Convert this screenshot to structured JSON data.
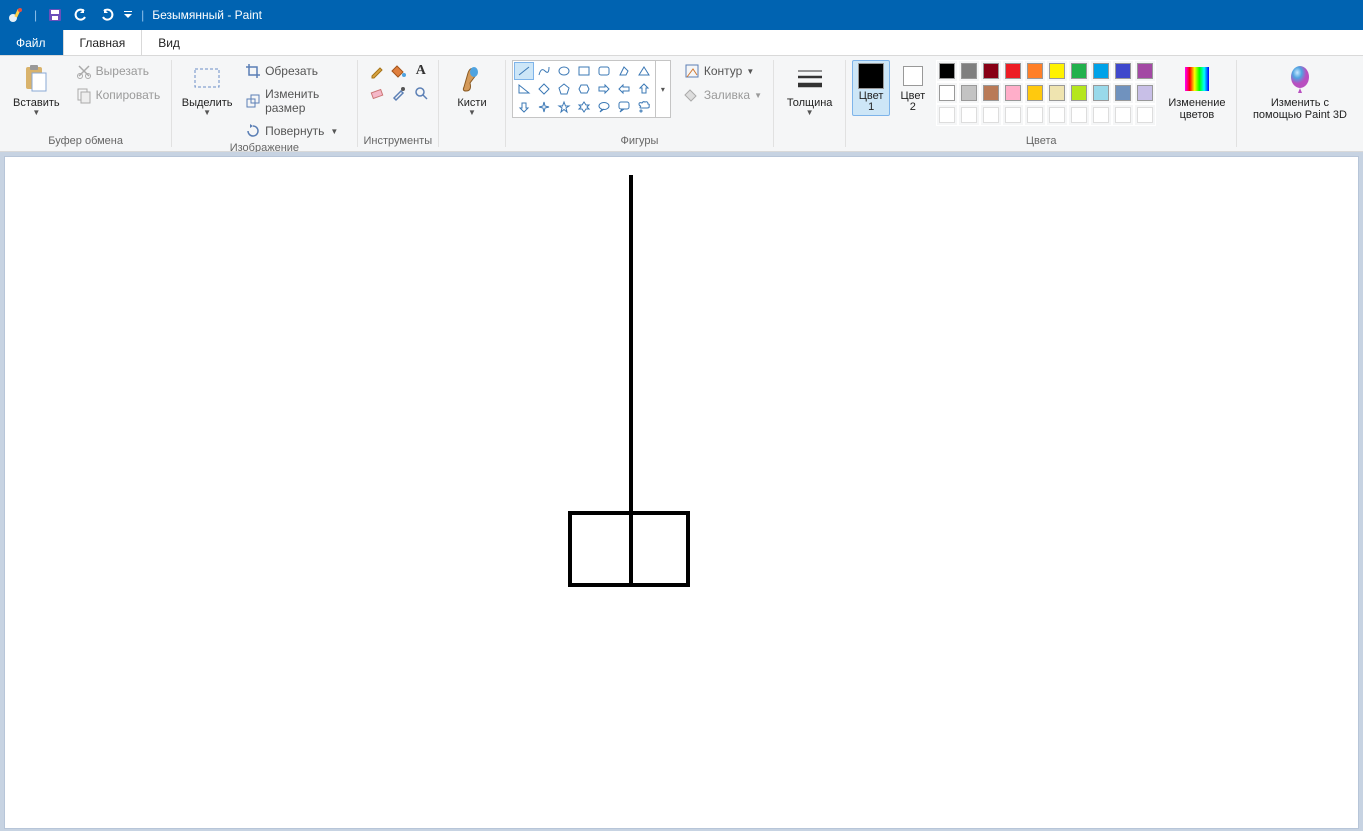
{
  "title": "Безымянный - Paint",
  "tabs": {
    "file": "Файл",
    "home": "Главная",
    "view": "Вид"
  },
  "clipboard": {
    "paste": "Вставить",
    "cut": "Вырезать",
    "copy": "Копировать",
    "label": "Буфер обмена"
  },
  "image": {
    "select": "Выделить",
    "crop": "Обрезать",
    "resize": "Изменить размер",
    "rotate": "Повернуть",
    "label": "Изображение"
  },
  "tools": {
    "label": "Инструменты"
  },
  "brushes": {
    "label": "Кисти"
  },
  "shapes": {
    "outline": "Контур",
    "fill": "Заливка",
    "label": "Фигуры"
  },
  "stroke": {
    "label": "Толщина"
  },
  "colors": {
    "c1": "Цвет 1",
    "c2": "Цвет 2",
    "edit": "Изменение цветов",
    "label": "Цвета"
  },
  "paint3d": {
    "line1": "Изменить с",
    "line2": "помощью Paint 3D"
  },
  "palette_row1": [
    "#000000",
    "#7f7f7f",
    "#880015",
    "#ed1c24",
    "#ff7f27",
    "#fff200",
    "#22b14c",
    "#00a2e8",
    "#3f48cc",
    "#a349a4"
  ],
  "palette_row2": [
    "#ffffff",
    "#c3c3c3",
    "#b97a57",
    "#ffaec9",
    "#ffc90e",
    "#efe4b0",
    "#b5e61d",
    "#99d9ea",
    "#7092be",
    "#c8bfe7"
  ],
  "color1_value": "#000000",
  "color2_value": "#ffffff"
}
